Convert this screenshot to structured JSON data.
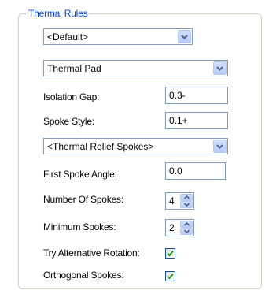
{
  "group": {
    "title": "Thermal Rules"
  },
  "rule_combo": {
    "value": "<Default>"
  },
  "pad_type_combo": {
    "value": "Thermal Pad"
  },
  "isolation_gap": {
    "label": "Isolation Gap:",
    "value": "0.3-"
  },
  "spoke_style": {
    "label": "Spoke Style:",
    "value": "0.1+"
  },
  "relief_combo": {
    "value": "<Thermal Relief Spokes>"
  },
  "first_spoke_angle": {
    "label": "First Spoke Angle:",
    "value": "0.0"
  },
  "number_of_spokes": {
    "label": "Number Of Spokes:",
    "value": "4"
  },
  "minimum_spokes": {
    "label": "Minimum Spokes:",
    "value": "2"
  },
  "try_alternative_rotation": {
    "label": "Try Alternative Rotation:",
    "checked": true
  },
  "orthogonal_spokes": {
    "label": "Orthogonal Spokes:",
    "checked": true
  },
  "colors": {
    "legend": "#0046d5",
    "border": "#7f9db9",
    "check": "#21a121"
  }
}
